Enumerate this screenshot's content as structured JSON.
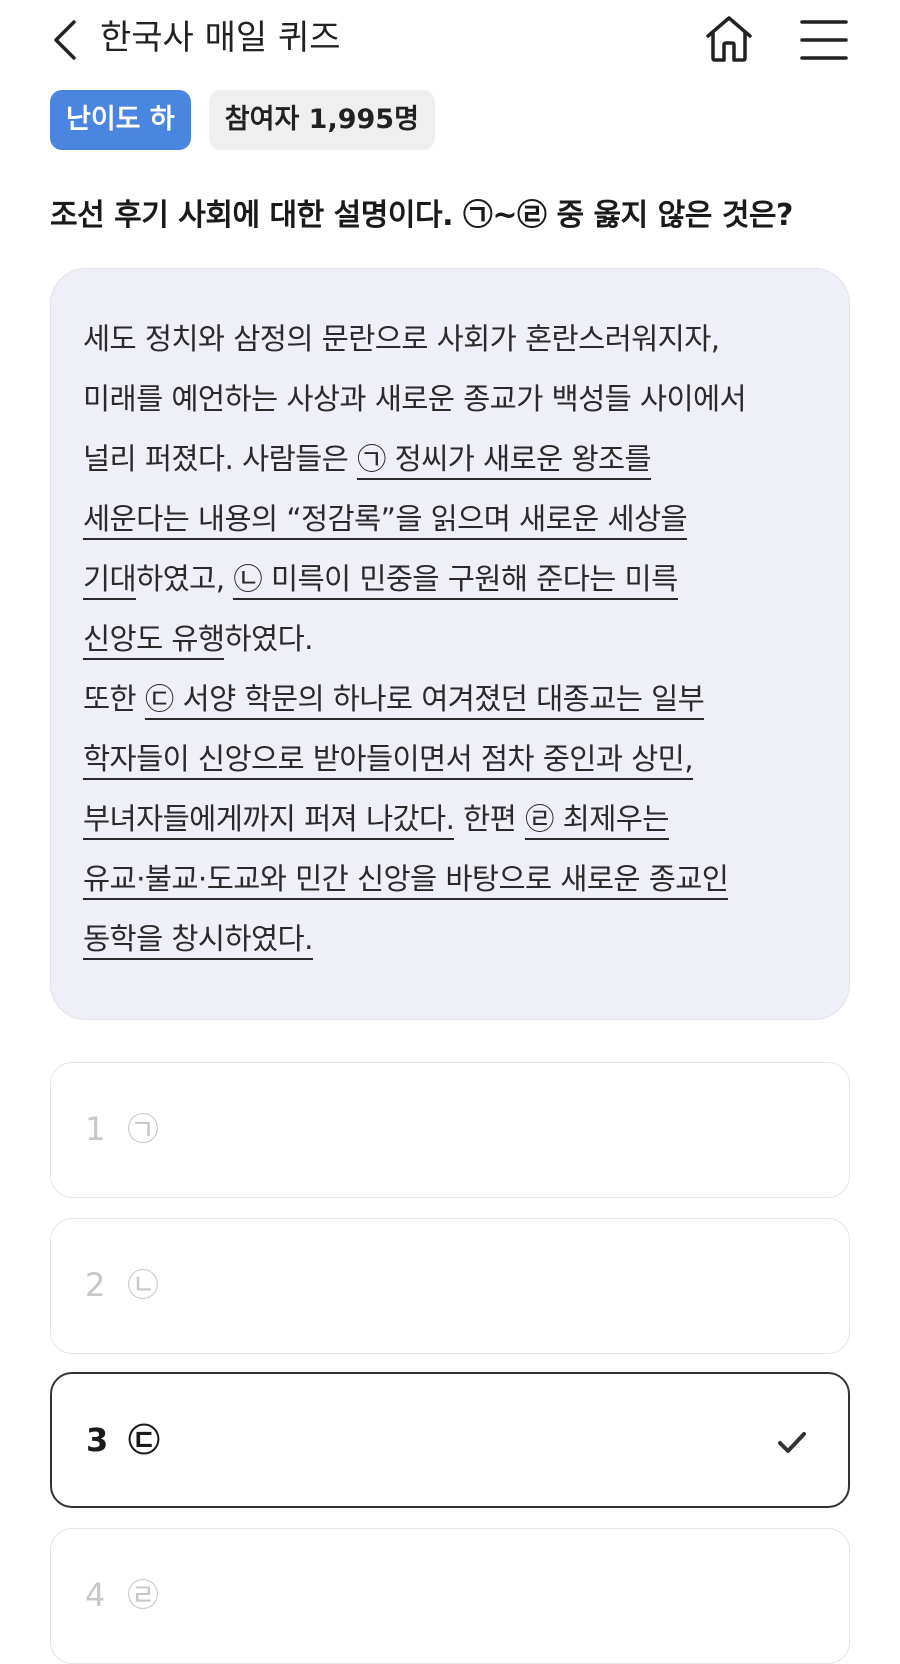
{
  "header": {
    "title": "한국사 매일 퀴즈",
    "back_icon": "chevron-left-icon",
    "home_icon": "home-icon",
    "menu_icon": "hamburger-menu-icon"
  },
  "badges": {
    "level": "난이도 하",
    "participants": "참여자 1,995명",
    "level_color": "#4a86e0"
  },
  "question": "조선 후기 사회에 대한 설명이다. ㉠~㉣ 중 옳지 않은 것은?",
  "passage": {
    "lines": [
      [
        "세도 정치와 삼정의 문란으로 사회가 혼란스러워지자,"
      ],
      [
        "미래를 예언하는 사상과 새로운 종교가 백성들 사이에서"
      ],
      [
        "널리 퍼졌다. 사람들은 ",
        "㉠ 정씨가 새로운 왕조를"
      ],
      [
        "",
        "세운다는 내용의 “정감록”을 읽으며 새로운 세상을"
      ],
      [
        "",
        "기대",
        "하였고, ",
        "㉡ 미륵이 민중을 구원해 준다는 미륵"
      ],
      [
        "",
        "신앙도 유행",
        "하였다."
      ],
      [
        "또한 ",
        "㉢ 서양 학문의 하나로 여겨졌던 대종교는 일부"
      ],
      [
        "",
        "학자들이 신앙으로 받아들이면서 점차 중인과 상민,"
      ],
      [
        "",
        "부녀자들에게까지 퍼져 나갔다.",
        " 한편 ",
        "㉣ 최제우는"
      ],
      [
        "",
        "유교·불교·도교와 민간 신앙을 바탕으로 새로운 종교인"
      ],
      [
        "",
        "동학을 창시하였다."
      ]
    ]
  },
  "options": [
    {
      "number": "1",
      "label": "㉠",
      "selected": false
    },
    {
      "number": "2",
      "label": "㉡",
      "selected": false
    },
    {
      "number": "3",
      "label": "㉢",
      "selected": true
    },
    {
      "number": "4",
      "label": "㉣",
      "selected": false
    }
  ],
  "check_icon": "checkmark-icon"
}
